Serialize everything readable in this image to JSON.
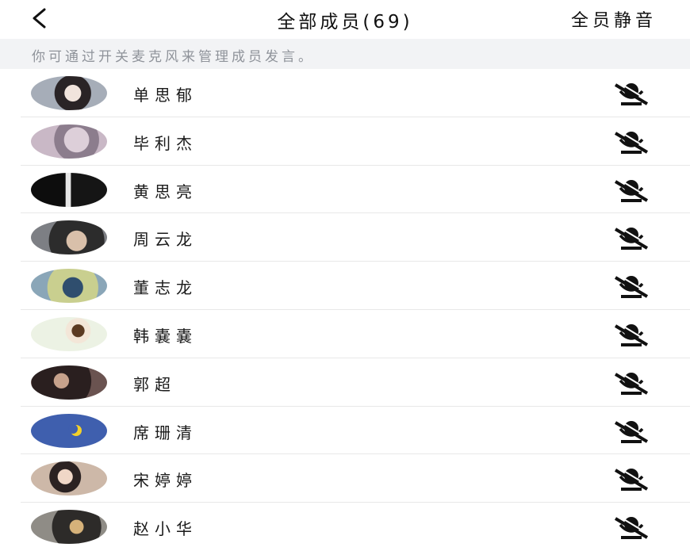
{
  "header": {
    "title": "全部成员(69)",
    "mute_all_label": "全员静音",
    "back_icon": "chevron-left-icon"
  },
  "notice": {
    "text": "你可通过开关麦克风来管理成员发言。"
  },
  "members": [
    {
      "name": "单思郁",
      "avatar_bg": "#8a8f99",
      "mic_icon": "mic-muted-icon"
    },
    {
      "name": "毕利杰",
      "avatar_bg": "#b6a5b9",
      "mic_icon": "mic-muted-icon"
    },
    {
      "name": "黄思亮",
      "avatar_bg": "#1b1b1b",
      "mic_icon": "mic-muted-icon"
    },
    {
      "name": "周云龙",
      "avatar_bg": "#4a4c52",
      "mic_icon": "mic-muted-icon"
    },
    {
      "name": "董志龙",
      "avatar_bg": "#b9c27d",
      "mic_icon": "mic-muted-icon"
    },
    {
      "name": "韩嚢嚢",
      "avatar_bg": "#e9efe0",
      "mic_icon": "mic-muted-icon"
    },
    {
      "name": "郭超",
      "avatar_bg": "#3b2e2e",
      "mic_icon": "mic-muted-icon"
    },
    {
      "name": "席珊清",
      "avatar_bg": "#3f5fae",
      "mic_icon": "mic-muted-icon"
    },
    {
      "name": "宋婷婷",
      "avatar_bg": "#b49a8c",
      "mic_icon": "mic-muted-icon"
    },
    {
      "name": "赵小华",
      "avatar_bg": "#5d5b57",
      "mic_icon": "mic-muted-icon"
    }
  ]
}
